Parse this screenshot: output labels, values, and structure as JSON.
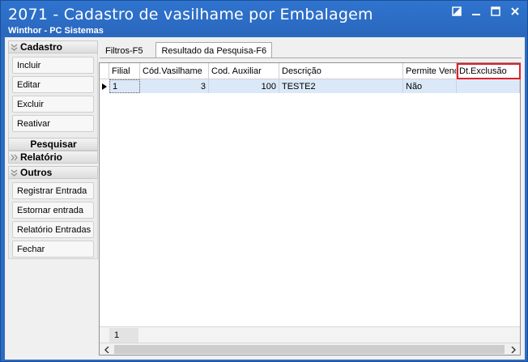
{
  "window": {
    "title": "2071 - Cadastro de vasilhame por Embalagem",
    "subtitle": "Winthor - PC Sistemas",
    "colors": {
      "titlebar": "#2b6cc1",
      "highlight": "#e0202a",
      "selected_row": "#dbe8f7"
    }
  },
  "menu": {
    "cadastro": {
      "header": "Cadastro",
      "items": [
        "Incluir",
        "Editar",
        "Excluir",
        "Reativar"
      ]
    },
    "pesquisar": {
      "header": "Pesquisar"
    },
    "relatorio": {
      "header": "Relatório"
    },
    "outros": {
      "header": "Outros",
      "items": [
        "Registrar Entrada",
        "Estornar entrada",
        "Relatório Entradas",
        "Fechar"
      ]
    }
  },
  "tabs": [
    {
      "label": "Filtros-F5",
      "active": false
    },
    {
      "label": "Resultado da Pesquisa-F6",
      "active": true
    }
  ],
  "grid": {
    "columns": [
      "Filial",
      "Cód.Vasilhame",
      "Cod. Auxiliar",
      "Descrição",
      "Permite Vend",
      "Dt.Exclusão"
    ],
    "rows": [
      {
        "filial": "1",
        "cod_vasilhame": "3",
        "cod_auxiliar": "100",
        "descricao": "TESTE2",
        "permite_venda": "Não",
        "dt_exclusao": ""
      }
    ],
    "footer_count": "1"
  }
}
